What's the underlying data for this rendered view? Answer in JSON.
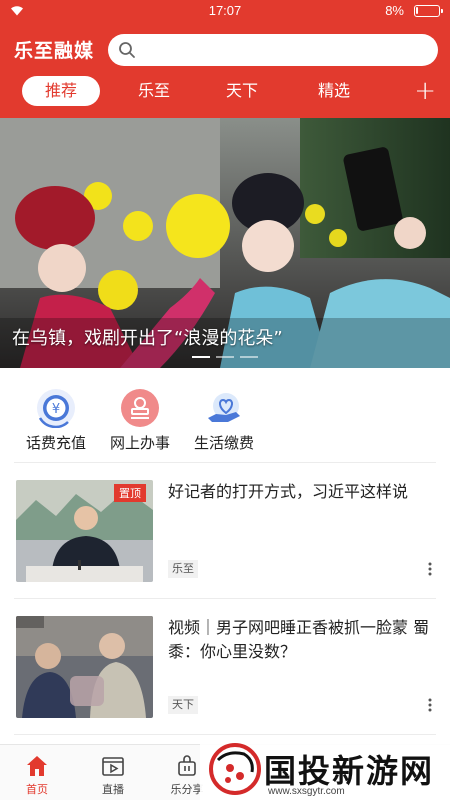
{
  "status_bar": {
    "time": "17:07",
    "battery_percent": "8%",
    "battery_level": 0.08,
    "wifi_icon": "wifi-icon"
  },
  "header": {
    "brand": "乐至融媒",
    "search": {
      "placeholder": "",
      "icon": "search-icon"
    },
    "tabs": [
      {
        "label": "推荐",
        "active": true
      },
      {
        "label": "乐至"
      },
      {
        "label": "天下"
      },
      {
        "label": "精选"
      }
    ],
    "add_icon": "plus-icon",
    "accent_color": "#e23a2e"
  },
  "banner": {
    "caption": "在乌镇，戏剧开出了“浪漫的花朵”",
    "slide_count": 3,
    "active_slide": 1
  },
  "services": [
    {
      "label": "话费充值",
      "icon": "phone-credit-icon"
    },
    {
      "label": "网上办事",
      "icon": "online-service-icon"
    },
    {
      "label": "生活缴费",
      "icon": "bill-payment-icon"
    }
  ],
  "news": [
    {
      "title": "好记者的打开方式，习近平这样说",
      "tag": "乐至",
      "badge": "置顶"
    },
    {
      "title": "视频｜男子网吧睡正香被抓一脸蒙 蜀黍：你心里没数？",
      "tag": "天下",
      "badge": ""
    }
  ],
  "bottom_nav": [
    {
      "label": "首页",
      "icon": "home-icon",
      "active": true
    },
    {
      "label": "直播",
      "icon": "live-icon"
    },
    {
      "label": "乐分享",
      "icon": "share-icon"
    }
  ],
  "watermark": {
    "text": "国投新游网",
    "url": "www.sxsgytr.com"
  }
}
